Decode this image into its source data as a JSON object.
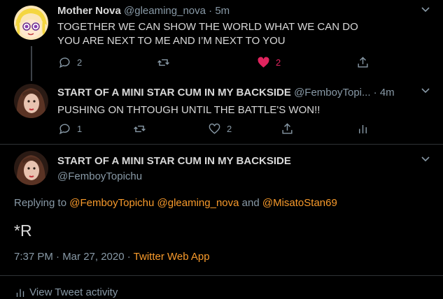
{
  "tweet1": {
    "name": "Mother Nova",
    "handle": "@gleaming_nova",
    "time": "5m",
    "text": "TOGETHER WE CAN SHOW THE WORLD WHAT WE CAN DO\nYOU ARE NEXT TO ME AND I’M NEXT TO YOU",
    "replies": "2",
    "likes": "2",
    "liked_color": "#e0245e"
  },
  "tweet2": {
    "name": "START OF A MINI STAR CUM IN MY BACKSIDE",
    "handle": "@FemboyTopi...",
    "time": "4m",
    "text": "PUSHING ON THTOUGH UNTIL THE BATTLE'S WON!!",
    "replies": "1",
    "likes": "2"
  },
  "main_tweet": {
    "name": "START OF A MINI STAR CUM IN MY BACKSIDE",
    "handle": "@FemboyTopichu",
    "replying_prefix": "Replying to",
    "mention1": "@FemboyTopichu",
    "mention2": "@gleaming_nova",
    "and": "and",
    "mention3": "@MisatoStan69",
    "text": "*R",
    "timestamp": "7:37 PM · Mar 27, 2020 ·",
    "source": "Twitter Web App",
    "footer": "View Tweet activity"
  },
  "colors": {
    "background": "#000000",
    "text": "#d9d9d9",
    "muted": "#8899a6",
    "accent": "#f89a2b",
    "like": "#e0245e"
  }
}
